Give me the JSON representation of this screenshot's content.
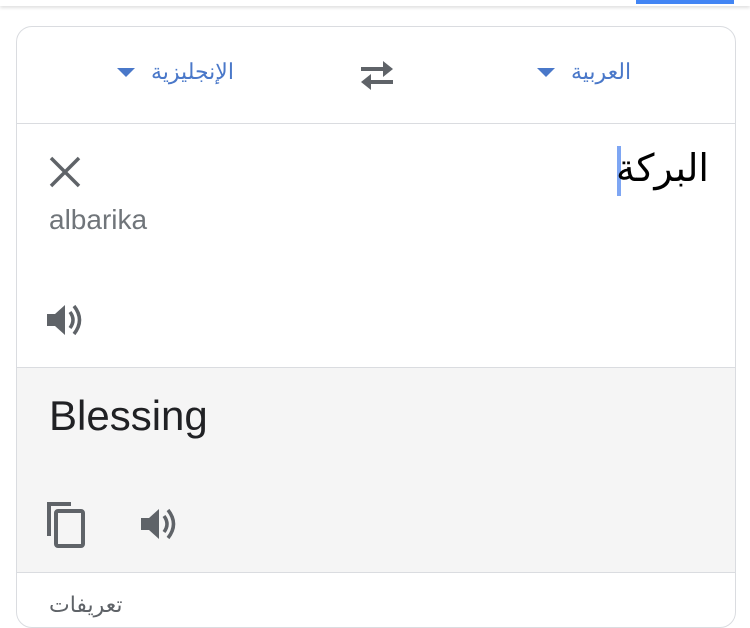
{
  "header": {
    "source_language": "العربية",
    "target_language": "الإنجليزية",
    "swap_icon": "swap-arrows-icon"
  },
  "source": {
    "text": "البركة",
    "transliteration": "albarika",
    "clear_icon": "close-icon",
    "speaker_icon": "speaker-icon"
  },
  "translation": {
    "text": "Blessing",
    "copy_icon": "copy-icon",
    "speaker_icon": "speaker-icon"
  },
  "footer": {
    "section_label": "تعريفات"
  },
  "colors": {
    "accent": "#4285f4",
    "link": "#4a78c9",
    "icon_gray": "#5f6368",
    "translation_bg": "#f5f5f5"
  }
}
